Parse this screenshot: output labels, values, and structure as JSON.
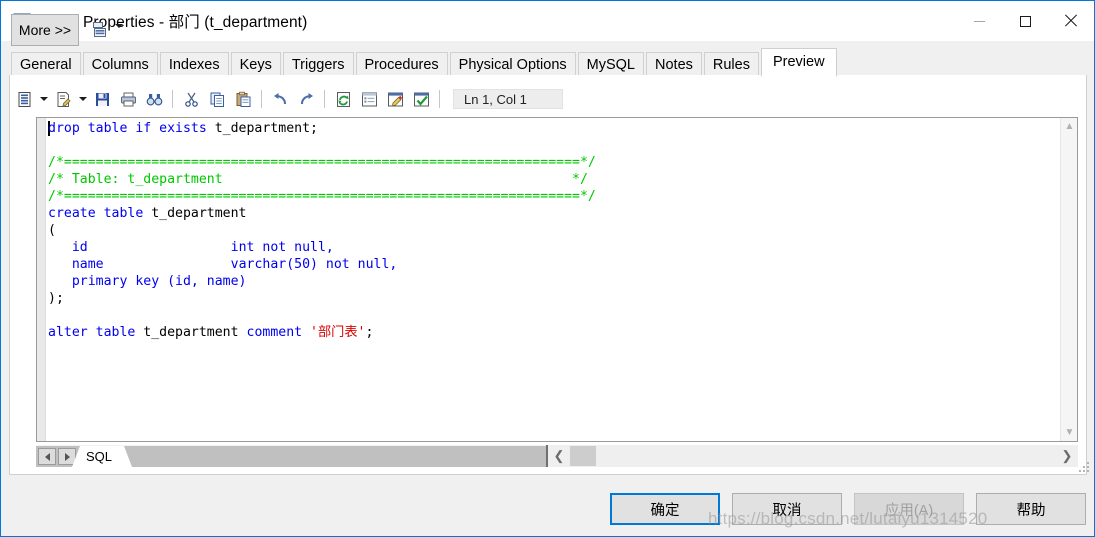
{
  "window": {
    "title": "Table Properties - 部门 (t_department)",
    "icon": "table-icon",
    "controls": {
      "minimize": "minimize-icon",
      "maximize": "maximize-icon",
      "close": "close-icon"
    }
  },
  "tabs": [
    {
      "label": "General",
      "active": false
    },
    {
      "label": "Columns",
      "active": false
    },
    {
      "label": "Indexes",
      "active": false
    },
    {
      "label": "Keys",
      "active": false
    },
    {
      "label": "Triggers",
      "active": false
    },
    {
      "label": "Procedures",
      "active": false
    },
    {
      "label": "Physical Options",
      "active": false
    },
    {
      "label": "MySQL",
      "active": false
    },
    {
      "label": "Notes",
      "active": false
    },
    {
      "label": "Rules",
      "active": false
    },
    {
      "label": "Preview",
      "active": true
    }
  ],
  "toolbar": {
    "items": [
      {
        "name": "copy-to-clipboard-icon",
        "dropdown": true
      },
      {
        "name": "edit-script-icon",
        "dropdown": true
      },
      {
        "name": "save-icon",
        "dropdown": false
      },
      {
        "name": "print-icon",
        "dropdown": false
      },
      {
        "name": "find-icon",
        "dropdown": false
      },
      {
        "name": "cut-icon",
        "dropdown": false
      },
      {
        "name": "copy-icon",
        "dropdown": false
      },
      {
        "name": "paste-icon",
        "dropdown": false
      },
      {
        "name": "undo-icon",
        "dropdown": false
      },
      {
        "name": "redo-icon",
        "dropdown": false
      },
      {
        "name": "refresh-icon",
        "dropdown": false
      },
      {
        "name": "properties-icon",
        "dropdown": false
      },
      {
        "name": "edit-window-icon",
        "dropdown": false
      },
      {
        "name": "validate-icon",
        "dropdown": false
      }
    ],
    "status": "Ln 1, Col 1"
  },
  "editor": {
    "lines": [
      [
        {
          "t": "drop table if exists ",
          "c": "k"
        },
        {
          "t": "t_department;",
          "c": "pl"
        }
      ],
      [
        {
          "t": "",
          "c": "pl"
        }
      ],
      [
        {
          "t": "/*=================================================================*/",
          "c": "cm"
        }
      ],
      [
        {
          "t": "/* Table: t_department                                            */",
          "c": "cm"
        }
      ],
      [
        {
          "t": "/*=================================================================*/",
          "c": "cm"
        }
      ],
      [
        {
          "t": "create table ",
          "c": "k"
        },
        {
          "t": "t_department",
          "c": "pl"
        }
      ],
      [
        {
          "t": "(",
          "c": "pl"
        }
      ],
      [
        {
          "t": "   id                  ",
          "c": "id2"
        },
        {
          "t": "int not null,",
          "c": "k"
        }
      ],
      [
        {
          "t": "   name                ",
          "c": "id2"
        },
        {
          "t": "varchar(50) not null,",
          "c": "k"
        }
      ],
      [
        {
          "t": "   primary key (id, name)",
          "c": "k"
        }
      ],
      [
        {
          "t": ");",
          "c": "pl"
        }
      ],
      [
        {
          "t": "",
          "c": "pl"
        }
      ],
      [
        {
          "t": "alter table ",
          "c": "k"
        },
        {
          "t": "t_department ",
          "c": "pl"
        },
        {
          "t": "comment ",
          "c": "k"
        },
        {
          "t": "'部门表'",
          "c": "st"
        },
        {
          "t": ";",
          "c": "pl"
        }
      ]
    ],
    "bottom_tab": "SQL",
    "nav_prev": "prev-tab-icon",
    "nav_next": "next-tab-icon",
    "vscroll_up": "scroll-up-icon",
    "vscroll_down": "scroll-down-icon",
    "hscroll_left": "scroll-left-icon",
    "hscroll_right": "scroll-right-icon"
  },
  "footer": {
    "more": "More >>",
    "more_icon": "script-options-icon",
    "ok": "确定",
    "cancel": "取消",
    "apply": "应用(A)",
    "help": "帮助"
  },
  "watermark": "https://blog.csdn.net/lutaiyu1314520",
  "colors": {
    "accent": "#0078d7",
    "keyword": "#0000ee",
    "comment": "#00c800",
    "string": "#dd0000",
    "window_bg": "#f0f0f0"
  }
}
